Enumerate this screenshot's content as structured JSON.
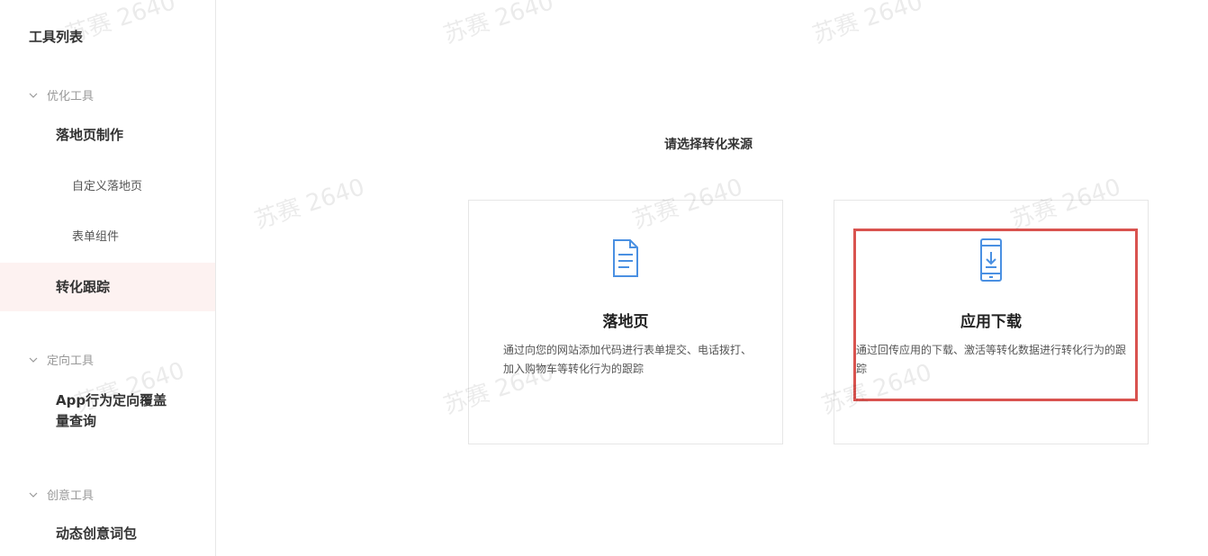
{
  "sidebar": {
    "title": "工具列表",
    "groups": [
      {
        "label": "优化工具"
      },
      {
        "label": "定向工具"
      },
      {
        "label": "创意工具"
      }
    ],
    "items": {
      "landing_make": "落地页制作",
      "custom_landing": "自定义落地页",
      "form_component": "表单组件",
      "conversion_track": "转化跟踪",
      "app_query_line1": "App行为定向覆盖",
      "app_query_line2": "量查询",
      "dynamic_words": "动态创意词包"
    }
  },
  "main": {
    "title": "请选择转化来源",
    "cards": [
      {
        "title": "落地页",
        "desc": "通过向您的网站添加代码进行表单提交、电话拨打、加入购物车等转化行为的跟踪",
        "icon": "document-icon"
      },
      {
        "title": "应用下载",
        "desc": "通过回传应用的下载、激活等转化数据进行转化行为的跟踪",
        "icon": "phone-download-icon"
      }
    ]
  },
  "watermark": "苏赛 2640",
  "colors": {
    "accent": "#4a90e2",
    "highlight": "#d9534f",
    "active_bg": "#fdf2f1"
  }
}
